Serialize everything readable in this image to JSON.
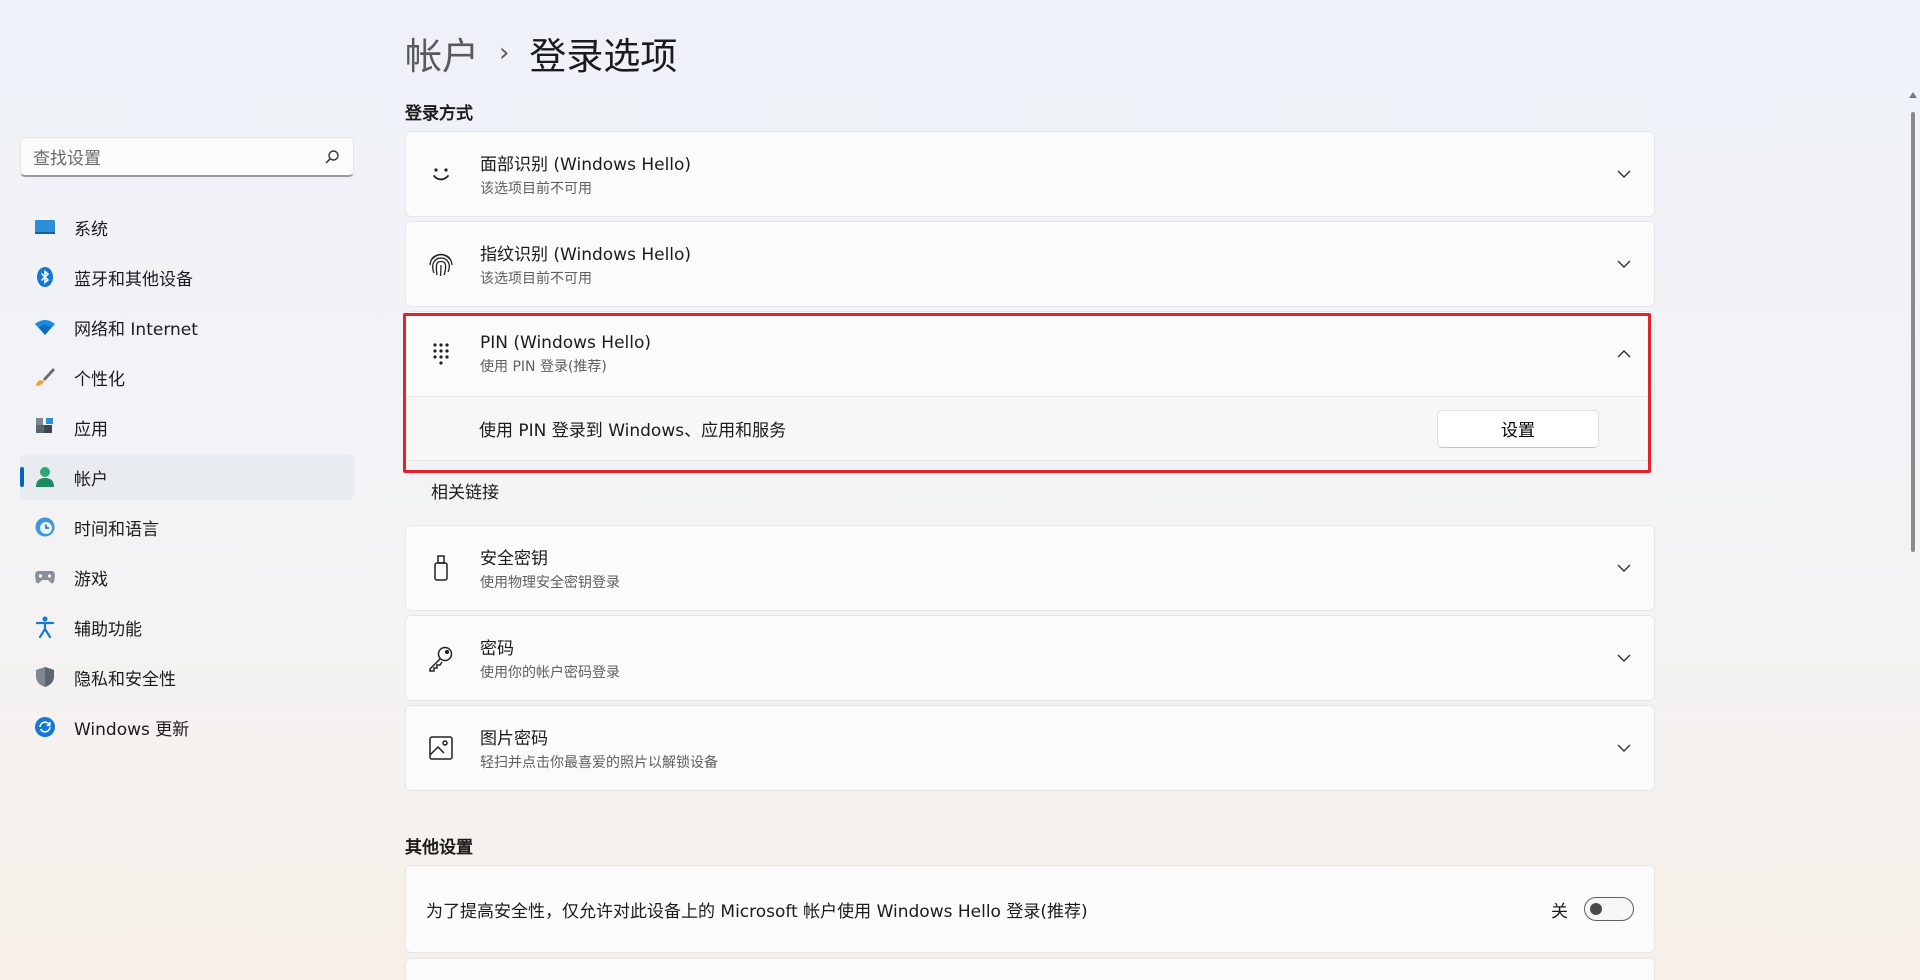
{
  "sidebar": {
    "search": {
      "placeholder": "查找设置",
      "icon": "search-icon"
    },
    "items": [
      {
        "label": "系统",
        "icon": "monitor-icon"
      },
      {
        "label": "蓝牙和其他设备",
        "icon": "bluetooth-icon"
      },
      {
        "label": "网络和 Internet",
        "icon": "wifi-icon"
      },
      {
        "label": "个性化",
        "icon": "brush-icon"
      },
      {
        "label": "应用",
        "icon": "apps-icon"
      },
      {
        "label": "帐户",
        "icon": "account-icon",
        "active": true
      },
      {
        "label": "时间和语言",
        "icon": "clock-globe-icon"
      },
      {
        "label": "游戏",
        "icon": "gamepad-icon"
      },
      {
        "label": "辅助功能",
        "icon": "accessibility-icon"
      },
      {
        "label": "隐私和安全性",
        "icon": "shield-icon"
      },
      {
        "label": "Windows 更新",
        "icon": "refresh-icon"
      }
    ]
  },
  "header": {
    "parent": "帐户",
    "separator": "›",
    "current": "登录选项"
  },
  "sign_in_section": {
    "title": "登录方式",
    "options": [
      {
        "title": "面部识别 (Windows Hello)",
        "subtitle": "该选项目前不可用",
        "icon": "face-icon",
        "expanded": false
      },
      {
        "title": "指纹识别 (Windows Hello)",
        "subtitle": "该选项目前不可用",
        "icon": "fingerprint-icon",
        "expanded": false
      },
      {
        "title": "PIN (Windows Hello)",
        "subtitle": "使用 PIN 登录(推荐)",
        "icon": "pin-keypad-icon",
        "expanded": true,
        "detail": {
          "text": "使用 PIN 登录到 Windows、应用和服务",
          "button": "设置"
        }
      },
      {
        "title": "安全密钥",
        "subtitle": "使用物理安全密钥登录",
        "icon": "usb-key-icon",
        "expanded": false
      },
      {
        "title": "密码",
        "subtitle": "使用你的帐户密码登录",
        "icon": "key-icon",
        "expanded": false
      },
      {
        "title": "图片密码",
        "subtitle": "轻扫并点击你最喜爱的照片以解锁设备",
        "icon": "picture-icon",
        "expanded": false
      }
    ],
    "related_links": "相关链接"
  },
  "other_section": {
    "title": "其他设置",
    "hello_only": {
      "text": "为了提高安全性，仅允许对此设备上的 Microsoft 帐户使用 Windows Hello 登录(推荐)",
      "toggle_label": "关",
      "toggle_on": false
    }
  },
  "colors": {
    "accent": "#0067c0",
    "highlight": "#e5212b"
  }
}
